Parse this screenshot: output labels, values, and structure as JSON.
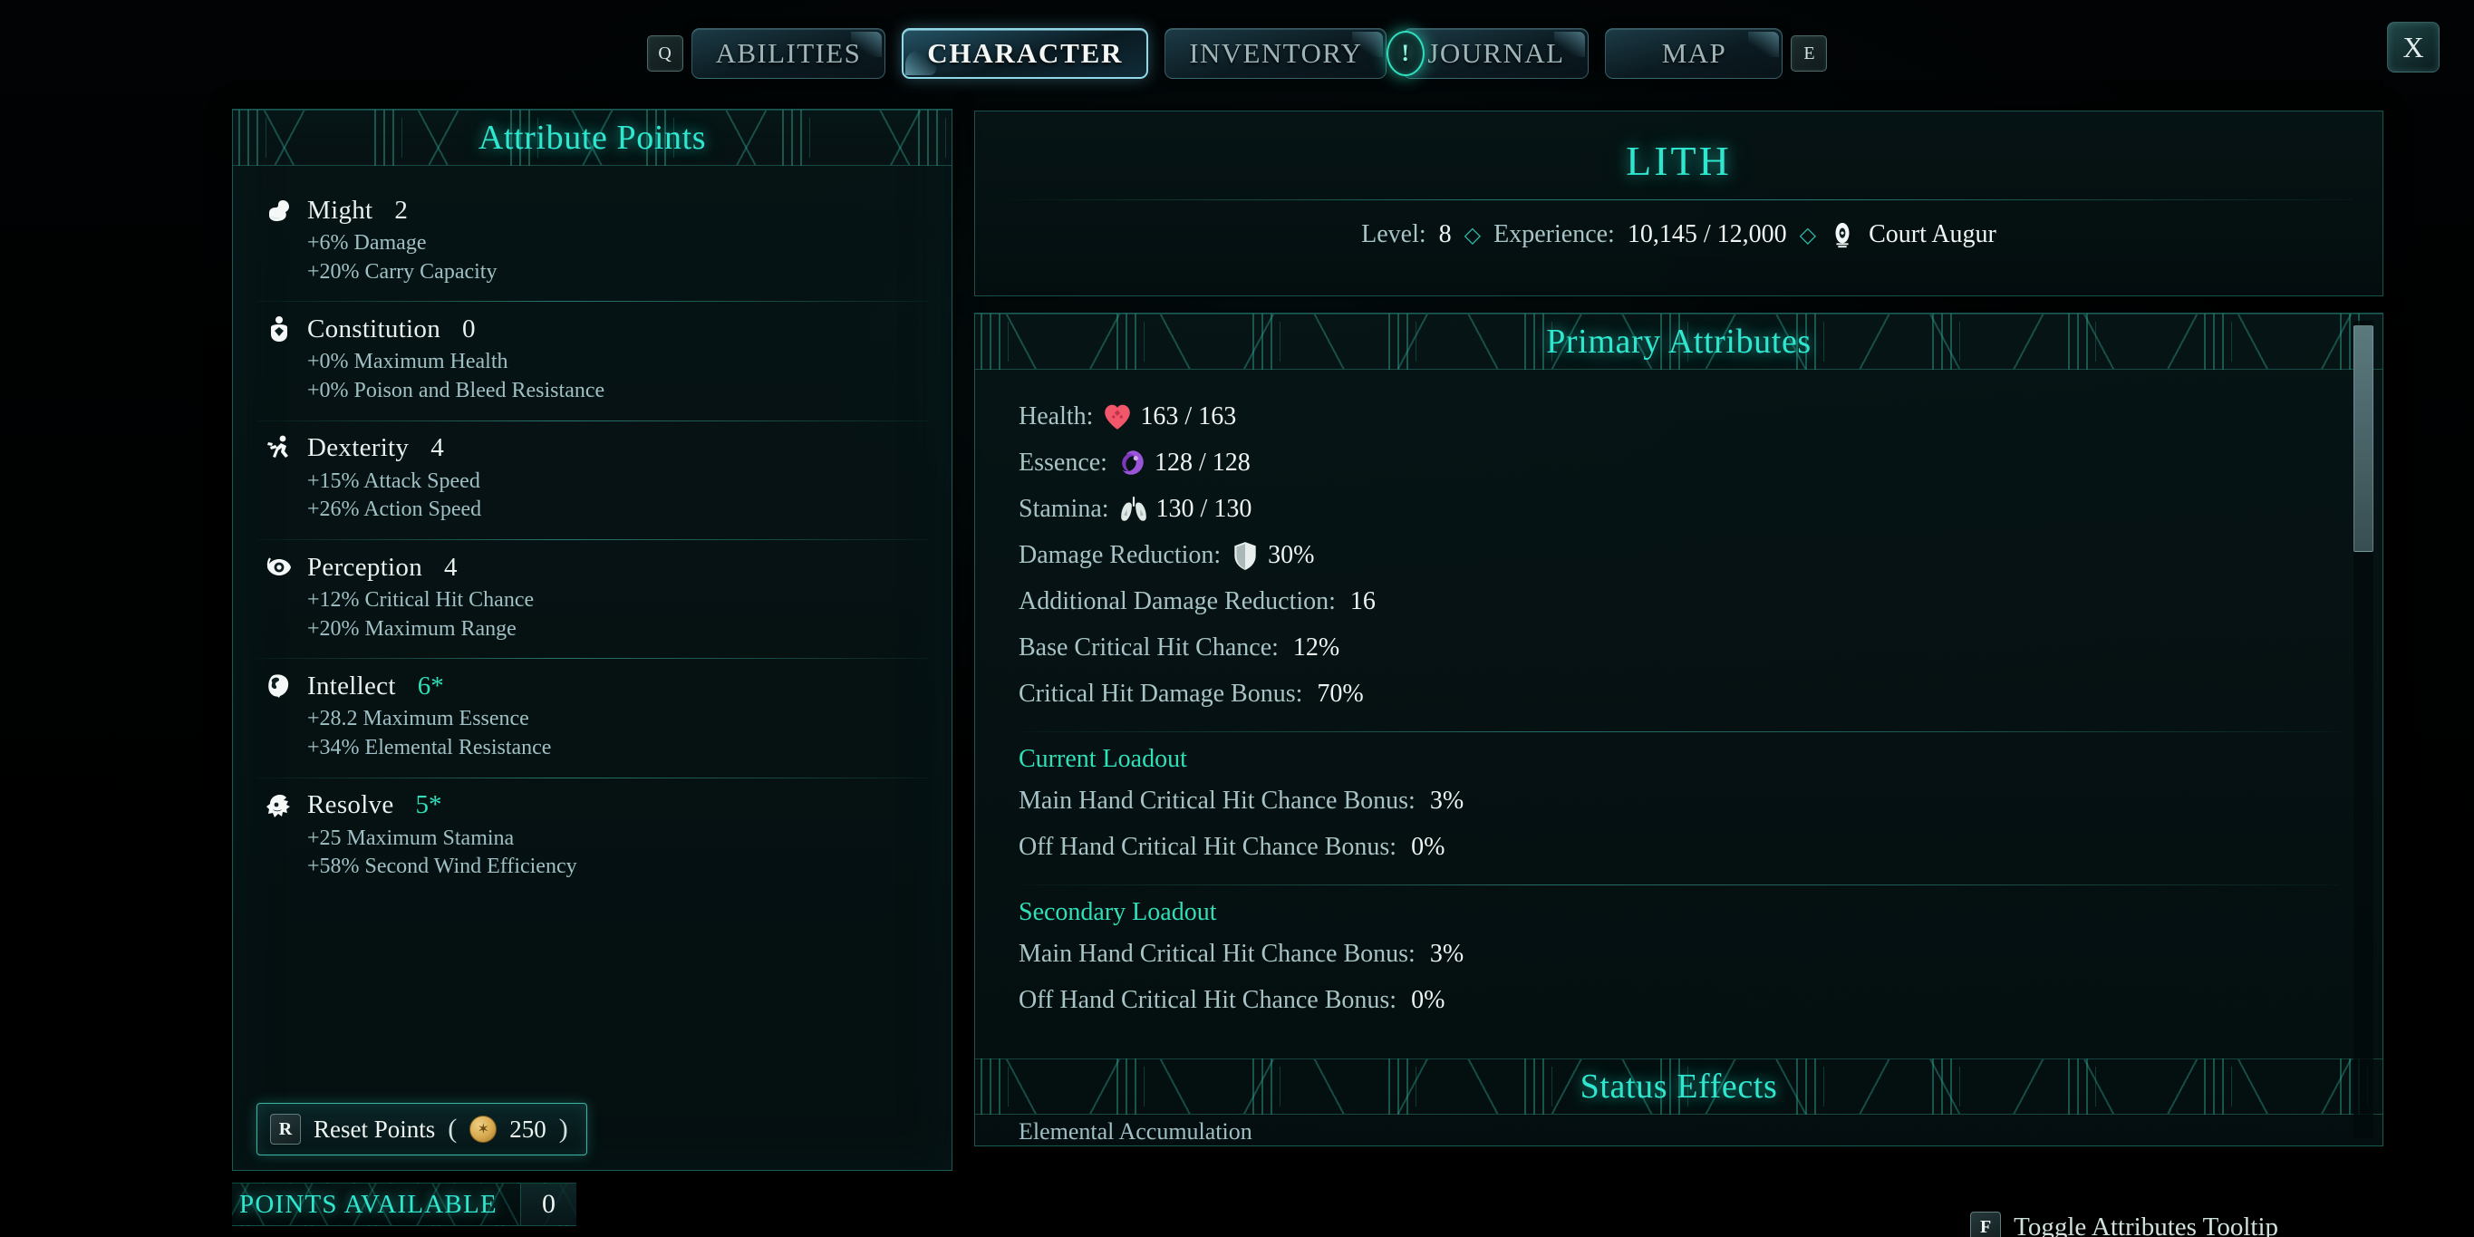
{
  "tabbar": {
    "left_keycap": "Q",
    "right_keycap": "E",
    "close_label": "X",
    "notification_badge": "!",
    "tabs": [
      {
        "label": "ABILITIES",
        "active": false
      },
      {
        "label": "CHARACTER",
        "active": true
      },
      {
        "label": "INVENTORY",
        "active": false
      },
      {
        "label": "JOURNAL",
        "active": false
      },
      {
        "label": "MAP",
        "active": false
      }
    ]
  },
  "attribute_panel": {
    "title": "Attribute Points",
    "attributes": [
      {
        "icon": "flexed-biceps-icon",
        "name": "Might",
        "value": "2",
        "buffed": false,
        "bonuses": [
          "+6% Damage",
          "+20% Carry Capacity"
        ]
      },
      {
        "icon": "heart-torso-icon",
        "name": "Constitution",
        "value": "0",
        "buffed": false,
        "bonuses": [
          "+0% Maximum Health",
          "+0% Poison and Bleed Resistance"
        ]
      },
      {
        "icon": "running-figure-icon",
        "name": "Dexterity",
        "value": "4",
        "buffed": false,
        "bonuses": [
          "+15% Attack Speed",
          "+26% Action Speed"
        ]
      },
      {
        "icon": "eye-icon",
        "name": "Perception",
        "value": "4",
        "buffed": false,
        "bonuses": [
          "+12% Critical Hit Chance",
          "+20% Maximum Range"
        ]
      },
      {
        "icon": "brain-head-icon",
        "name": "Intellect",
        "value": "6*",
        "buffed": true,
        "bonuses": [
          "+28.2 Maximum Essence",
          "+34% Elemental Resistance"
        ]
      },
      {
        "icon": "resolve-head-icon",
        "name": "Resolve",
        "value": "5*",
        "buffed": true,
        "bonuses": [
          "+25 Maximum Stamina",
          "+58% Second Wind Efficiency"
        ]
      }
    ],
    "reset": {
      "keycap": "R",
      "label": "Reset Points",
      "open_paren": "(",
      "currency_icon": "gold-coin-icon",
      "cost": "250",
      "close_paren": ")"
    },
    "points_available": {
      "label": "POINTS AVAILABLE",
      "value": "0"
    }
  },
  "character": {
    "name": "LITH",
    "level_label": "Level:",
    "level_value": "8",
    "separator": "◇",
    "experience_label": "Experience:",
    "experience_value": "10,145 / 12,000",
    "title_icon": "augur-eye-icon",
    "title": "Court Augur"
  },
  "primary_attributes": {
    "title": "Primary Attributes",
    "rows": [
      {
        "label": "Health:",
        "icon": "heart-icon",
        "value": "163 / 163"
      },
      {
        "label": "Essence:",
        "icon": "essence-swirl-icon",
        "value": "128 / 128"
      },
      {
        "label": "Stamina:",
        "icon": "lungs-icon",
        "value": "130 / 130"
      },
      {
        "label": "Damage Reduction:",
        "icon": "shield-icon",
        "value": "30%"
      },
      {
        "label": "Additional Damage Reduction:",
        "icon": "",
        "value": "16"
      },
      {
        "label": "Base Critical Hit Chance:",
        "icon": "",
        "value": "12%"
      },
      {
        "label": "Critical Hit Damage Bonus:",
        "icon": "",
        "value": "70%"
      }
    ],
    "current_loadout": {
      "title": "Current Loadout",
      "rows": [
        {
          "label": "Main Hand Critical Hit Chance Bonus:",
          "value": "3%"
        },
        {
          "label": "Off Hand Critical Hit Chance Bonus:",
          "value": "0%"
        }
      ]
    },
    "secondary_loadout": {
      "title": "Secondary Loadout",
      "rows": [
        {
          "label": "Main Hand Critical Hit Chance Bonus:",
          "value": "3%"
        },
        {
          "label": "Off Hand Critical Hit Chance Bonus:",
          "value": "0%"
        }
      ]
    },
    "status_effects_title": "Status Effects",
    "status_effects_clipped": "Elemental Accumulation"
  },
  "footer_hint": {
    "keycap": "F",
    "label": "Toggle Attributes Tooltip"
  },
  "colors": {
    "accent_teal": "#2fe6cf",
    "buff_green": "#2fe0b8",
    "label_blue": "#a8c4c6",
    "value_white": "#eef5f3",
    "health_red": "#f2566a",
    "essence_purple": "#9a54d8",
    "gold": "#d7a94e"
  }
}
